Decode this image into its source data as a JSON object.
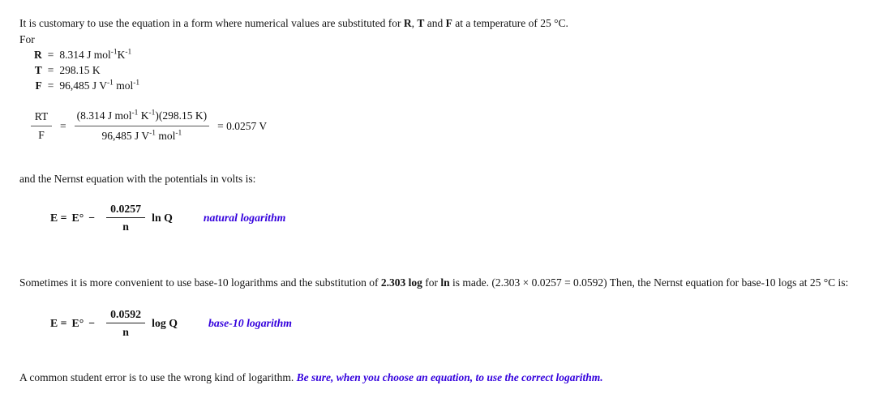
{
  "document": {
    "intro": {
      "text_before_R": "It is customary to use the equation in a form where numerical values are substituted for ",
      "sym_R": "R",
      "text_comma": ", ",
      "sym_T": "T",
      "text_and": " and ",
      "sym_F": "F",
      "text_after": " at a temperature of 25 °C."
    },
    "for_label": "For",
    "constants": [
      {
        "symbol": "R",
        "equals": "=",
        "value": "8.314 J mol",
        "sup1": "-1",
        "unit2": "K",
        "sup2": "-1",
        "tail": ""
      },
      {
        "symbol": "T",
        "equals": "=",
        "value": "298.15 K",
        "sup1": "",
        "unit2": "",
        "sup2": "",
        "tail": ""
      },
      {
        "symbol": "F",
        "equals": "=",
        "value": "96,485 J V",
        "sup1": "-1",
        "unit2": " mol",
        "sup2": "-1",
        "tail": ""
      }
    ],
    "rtf_equation": {
      "left_numerator": "RT",
      "left_denominator": "F",
      "equals": "=",
      "right_numerator_a": "(8.314 J mol",
      "right_numerator_sup1": "-1",
      "right_numerator_b": " K",
      "right_numerator_sup2": "-1",
      "right_numerator_c": ")(298.15 K)",
      "right_denominator_a": "96,485 J V",
      "right_denominator_sup1": "-1",
      "right_denominator_b": " mol",
      "right_denominator_sup2": "-1",
      "result": "= 0.0257 V"
    },
    "nernst_intro": "and the Nernst equation with the potentials in volts is:",
    "equation_ln": {
      "lhs": "E =",
      "e_standard": "E°",
      "minus": "−",
      "numerator": "0.0257",
      "denominator": "n",
      "log_term": "ln Q",
      "note": "natural logarithm"
    },
    "base10_paragraph": {
      "part1": "Sometimes it is more convenient to use base-10 logarithms and the substitution of ",
      "bold1": "2.303 log",
      "part2": " for ",
      "bold2": "ln",
      "part3": " is made. (2.303 × 0.0257 = 0.0592)  Then, the Nernst equation for base-10 logs at 25 °C is:"
    },
    "equation_log": {
      "lhs": "E =",
      "e_standard": "E°",
      "minus": "−",
      "numerator": "0.0592",
      "denominator": "n",
      "log_term": "log Q",
      "note": "base-10 logarithm"
    },
    "closing": {
      "plain": "A common student error is to use the wrong kind of logarithm. ",
      "emphasis": "Be sure, when you choose an equation, to use the correct logarithm."
    },
    "colors": {
      "accent": "#3300dd",
      "text": "#141414",
      "rule": "#555555",
      "background": "#ffffff"
    }
  }
}
